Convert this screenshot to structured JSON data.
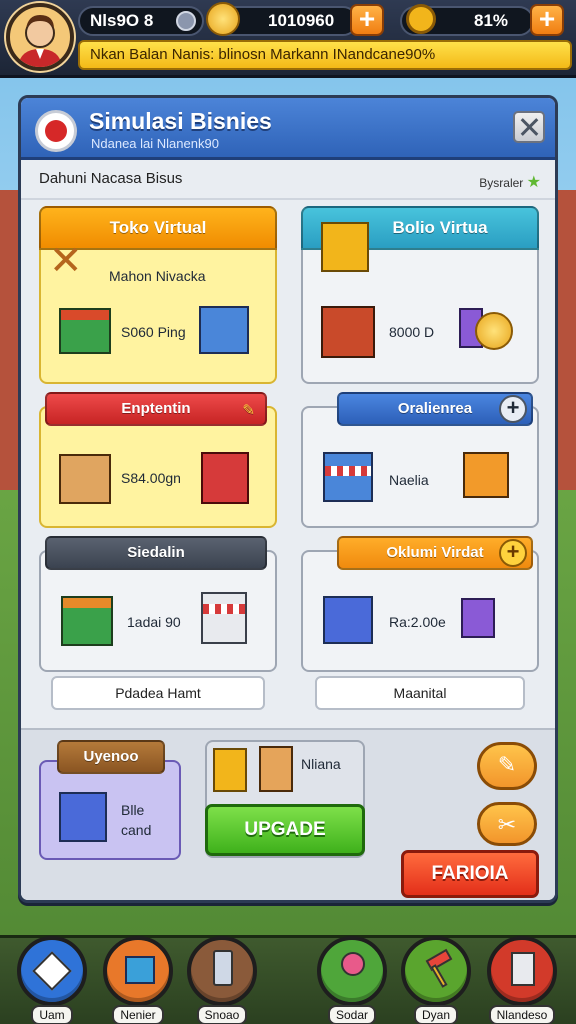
{
  "topbar": {
    "player_name": "Nls9O 8",
    "coins": "1010960",
    "gems": "81%",
    "plus": "+",
    "banner": "Nkan Balan Nanis: blinosn Markann INandcane90%"
  },
  "panel": {
    "title": "Simulasi Bisnies",
    "subtitle": "Ndanea lai Nlanenk90",
    "section_title": "Dahuni Nacasa Bisus",
    "section_right": "Bysraler",
    "cards": {
      "toko": {
        "header": "Toko Virtual",
        "line1": "Mahon Nivacka",
        "value": "S060 Ping"
      },
      "bolio": {
        "header": "Bolio Virtua",
        "value": "8000 D"
      },
      "enpentin": {
        "header": "Enptentin",
        "value": "S84.00gn"
      },
      "oralien": {
        "header": "Oralienrea",
        "value": "Naelia"
      },
      "siedalin": {
        "header": "Siedalin",
        "value": "1adai 90",
        "button": "Pdadea Hamt"
      },
      "oklumi": {
        "header": "Oklumi Virdat",
        "value": "Ra:2.00e",
        "button": "Maanital"
      },
      "upgrade_card": {
        "header": "Uyenoo",
        "text1": "Blle",
        "text2": "cand"
      },
      "mid_card": {
        "text": "Nliana",
        "button": "UPGADE"
      },
      "action_button": "FARIOIA"
    }
  },
  "bottom_nav": {
    "items": [
      {
        "label": "Uam",
        "color": "#2f73d8"
      },
      {
        "label": "Nenier",
        "color": "#e8782a"
      },
      {
        "label": "Snoao",
        "color": "#8a5a3a"
      },
      {
        "label": "Sodar",
        "color": "#4fa63a"
      },
      {
        "label": "Dyan",
        "color": "#5aa52e"
      },
      {
        "label": "Nlandeso",
        "color": "#d23a2a"
      }
    ]
  }
}
